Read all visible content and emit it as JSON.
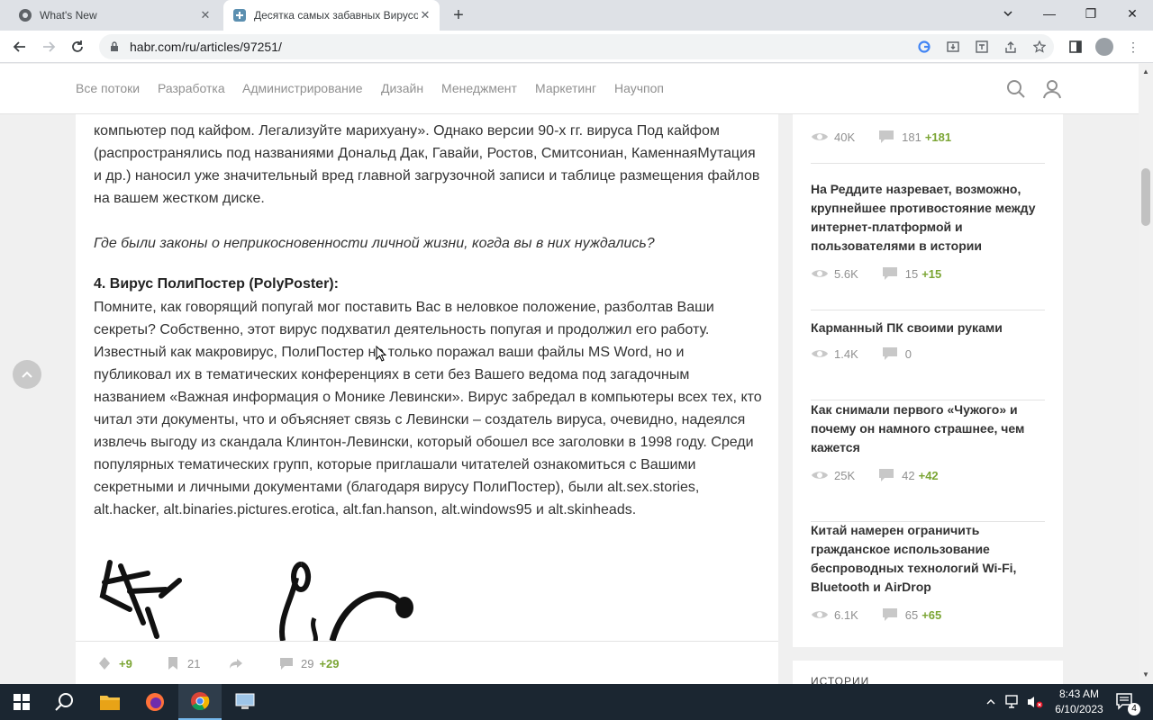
{
  "browser": {
    "tabs": [
      {
        "title": "What's New"
      },
      {
        "title": "Десятка самых забавных Вирусов"
      }
    ],
    "new_tab_label": "+",
    "url": "habr.com/ru/articles/97251/",
    "window_controls": {
      "minimize": "—",
      "restore": "❐",
      "close": "✕"
    }
  },
  "site": {
    "nav": [
      "Все потоки",
      "Разработка",
      "Администрирование",
      "Дизайн",
      "Менеджмент",
      "Маркетинг",
      "Научпоп"
    ]
  },
  "article": {
    "p1": "компьютер под кайфом. Легализуйте марихуану». Однако версии 90-х гг. вируса Под кайфом (распространялись под названиями Дональд Дак, Гавайи, Ростов, Смитсониан, КаменнаяМутация и др.) наносил уже значительный вред главной загрузочной записи и таблице размещения файлов на вашем жестком диске.",
    "p2": "Где были законы о неприкосновенности личной жизни, когда вы в них нуждались?",
    "heading": "4. Вирус ПолиПостер (PolyPoster):",
    "p3": "Помните, как говорящий попугай мог поставить Вас в неловкое положение, разболтав Ваши секреты? Собственно, этот вирус подхватил деятельность попугая и продолжил его работу. Известный как макровирус, ПолиПостер не только поражал ваши файлы MS Word, но и публиковал их в тематических конференциях в сети без Вашего ведома под загадочным названием «Важная информация о Монике Левински». Вирус забредал в компьютеры всех тех, кто читал эти документы, что и объясняет связь с Левински – создатель вируса, очевидно, надеялся извлечь выгоду из скандала Клинтон-Левински, который обошел все заголовки в 1998 году. Среди популярных тематических групп, которые приглашали читателей ознакомиться с Вашими секретными и личными документами (благодаря вирусу ПолиПостер), были alt.sex.stories, alt.hacker, alt.binaries.pictures.erotica, alt.fan.hanson, alt.windows95 и alt.skinheads."
  },
  "article_footer": {
    "votes": "+9",
    "bookmarks": "21",
    "comments": "29",
    "comments_new": "+29"
  },
  "sidebar": {
    "top_meta": {
      "views": "40K",
      "comments": "181",
      "new": "+181"
    },
    "posts": [
      {
        "title": "На Реддите назревает, возможно, крупнейшее противостояние между интернет-платформой и пользователями в истории",
        "views": "5.6K",
        "comments": "15",
        "new": "+15"
      },
      {
        "title": "Карманный ПК своими руками",
        "views": "1.4K",
        "comments": "0",
        "new": ""
      },
      {
        "title": "Как снимали первого «Чужого» и почему он намного страшнее, чем кажется",
        "views": "25K",
        "comments": "42",
        "new": "+42"
      },
      {
        "title": "Китай намерен ограничить гражданское использование беспроводных технологий Wi-Fi, Bluetooth и AirDrop",
        "views": "6.1K",
        "comments": "65",
        "new": "+65"
      }
    ],
    "stories_heading": "ИСТОРИИ"
  },
  "taskbar": {
    "time": "8:43 AM",
    "date": "6/10/2023",
    "notifications": "4"
  },
  "colors": {
    "accent_green": "#7ba534",
    "nav_gray": "#909090",
    "taskbar_bg": "#1b2631"
  }
}
